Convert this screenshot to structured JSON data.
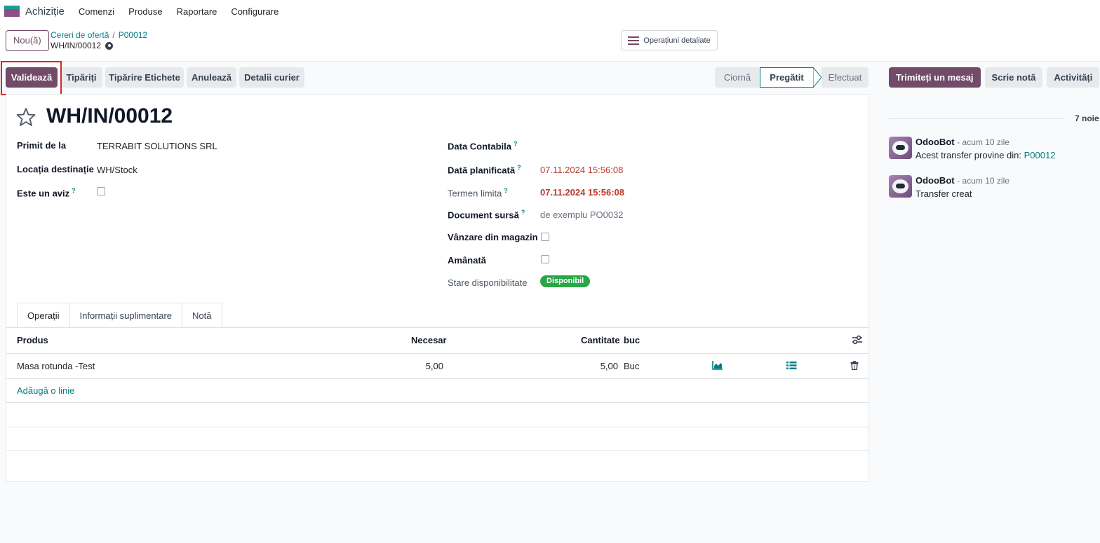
{
  "topnav": {
    "app_name": "Achiziție",
    "menu": [
      "Comenzi",
      "Produse",
      "Raportare",
      "Configurare"
    ]
  },
  "control": {
    "new_button": "Nou(ă)",
    "breadcrumb": [
      "Cereri de ofertă",
      "P00012"
    ],
    "breadcrumb_sep": "/",
    "current": "WH/IN/00012",
    "ops_button": "Operațiuni detaliate"
  },
  "actions": {
    "validate": "Validează",
    "print": "Tipăriți",
    "print_labels": "Tipărire Etichete",
    "cancel": "Anulează",
    "courier": "Detalii curier"
  },
  "status": {
    "stages": [
      "Ciornă",
      "Pregătit",
      "Efectuat"
    ],
    "active": "Pregătit"
  },
  "record": {
    "title": "WH/IN/00012",
    "left_fields": [
      {
        "label": "Primit de la",
        "value": "TERRABIT SOLUTIONS SRL"
      },
      {
        "label": "Locația destinație",
        "value": "WH/Stock"
      },
      {
        "label": "Este un aviz",
        "help": "?"
      }
    ],
    "right_fields": [
      {
        "label": "Data Contabila",
        "help": "?",
        "value": ""
      },
      {
        "label": "Dată planificată",
        "help": "?",
        "value": "07.11.2024 15:56:08"
      },
      {
        "label": "Termen limita",
        "help": "?",
        "value": "07.11.2024 15:56:08"
      },
      {
        "label": "Document sursă",
        "help": "?",
        "placeholder": "de exemplu PO0032"
      },
      {
        "label": "Vânzare din magazin"
      },
      {
        "label": "Amânată"
      },
      {
        "label": "Stare disponibilitate",
        "value": "Disponibil"
      }
    ]
  },
  "tabs": [
    "Operații",
    "Informații suplimentare",
    "Notă"
  ],
  "table": {
    "headers": {
      "product": "Produs",
      "required": "Necesar",
      "quantity": "Cantitate",
      "uom": "buc"
    },
    "rows": [
      {
        "product": "Masa rotunda -Test",
        "required": "5,00",
        "quantity": "5,00",
        "uom": "Buc"
      }
    ],
    "add_line": "Adăugă o linie"
  },
  "chatter": {
    "send_message": "Trimiteți un mesaj",
    "log_note": "Scrie notă",
    "activities": "Activități",
    "date_separator": "7 noie",
    "messages": [
      {
        "author": "OdooBot",
        "time": "- acum 10 zile",
        "body": "Acest transfer provine din: ",
        "link": "P00012"
      },
      {
        "author": "OdooBot",
        "time": "- acum 10 zile",
        "body": "Transfer creat",
        "link": ""
      }
    ]
  },
  "colors": {
    "brand": "#714b67",
    "link": "#017e84",
    "danger": "#c0392b",
    "success": "#28a745"
  }
}
